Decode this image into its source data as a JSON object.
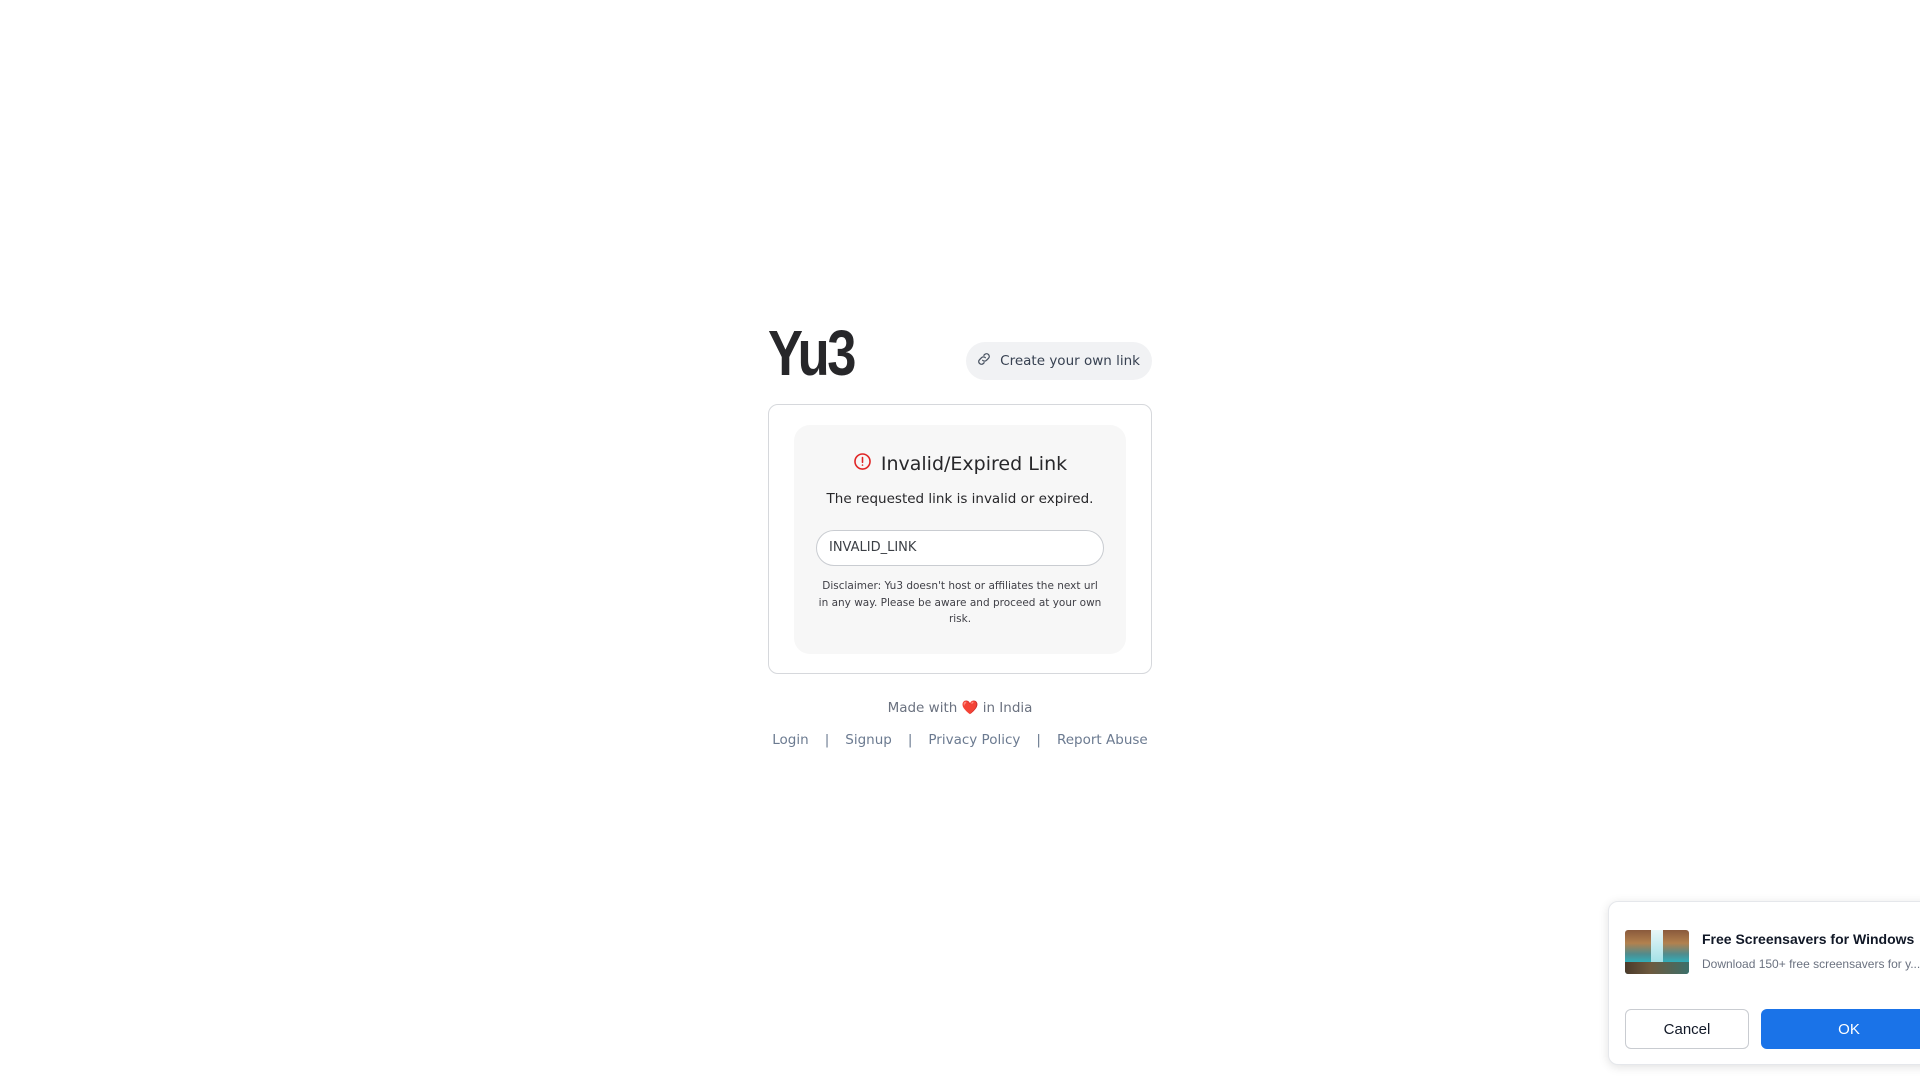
{
  "header": {
    "logo": "Yu3",
    "create_link_label": "Create your own link",
    "create_link_icon": "link-icon"
  },
  "card": {
    "title": "Invalid/Expired Link",
    "title_icon": "alert-circle-icon",
    "message": "The requested link is invalid or expired.",
    "url_value": "INVALID_LINK",
    "disclaimer": "Disclaimer: Yu3 doesn't host or affiliates the next url in any way. Please be aware and proceed at your own risk."
  },
  "footer": {
    "made_prefix": "Made with",
    "made_heart": "❤️",
    "made_suffix": "in India",
    "links": [
      "Login",
      "Signup",
      "Privacy Policy",
      "Report Abuse"
    ],
    "separator": "|"
  },
  "popup": {
    "title": "Free Screensavers for Windows",
    "description": "Download 150+ free screensavers for y...",
    "cancel_label": "Cancel",
    "ok_label": "OK"
  },
  "colors": {
    "accent": "#1a73e8",
    "alert": "#e02424",
    "link": "#6b7a90"
  }
}
